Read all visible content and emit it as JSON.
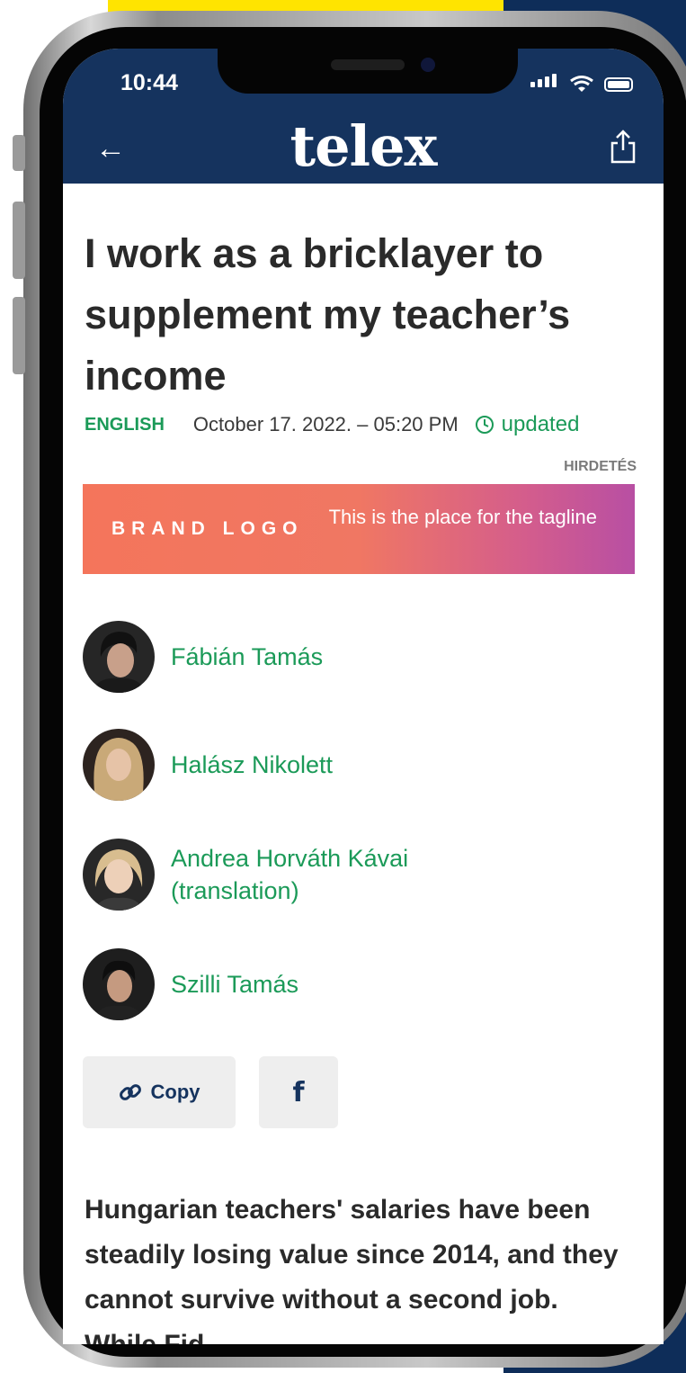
{
  "status_bar": {
    "time": "10:44"
  },
  "header": {
    "logo": "telex"
  },
  "article": {
    "title": "I work as a bricklayer to supplement my teacher’s income",
    "category": "ENGLISH",
    "date": "October 17. 2022. – 05:20 PM",
    "updated_label": "updated",
    "lead": "Hungarian teachers' salaries have been steadily losing value since 2014, and they cannot survive without a second job. While Fid"
  },
  "ad": {
    "label": "HIRDETÉS",
    "brand": "BRAND LOGO",
    "tagline": "This is the place for the tagline"
  },
  "authors": [
    {
      "name": "Fábián Tamás"
    },
    {
      "name": "Halász Nikolett"
    },
    {
      "name": "Andrea Horváth Kávai (translation)"
    },
    {
      "name": "Szilli Tamás"
    }
  ],
  "share": {
    "copy_label": "Copy",
    "facebook_label": "f"
  },
  "colors": {
    "navy": "#15335e",
    "green": "#1b9a58",
    "yellow": "#ffe400"
  }
}
